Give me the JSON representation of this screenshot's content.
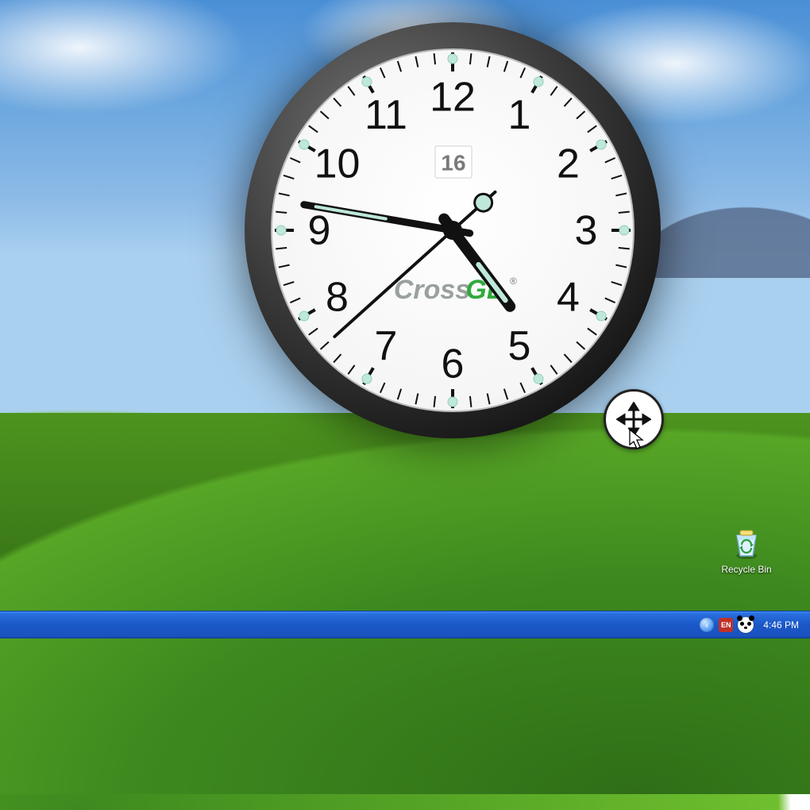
{
  "clock": {
    "numerals": [
      "12",
      "1",
      "2",
      "3",
      "4",
      "5",
      "6",
      "7",
      "8",
      "9",
      "10",
      "11"
    ],
    "date_box": "16",
    "brand_gray": "Cross",
    "brand_green": "GL",
    "brand_suffix": "®",
    "hour": 4,
    "minute": 46,
    "second": 38
  },
  "desktop": {
    "recycle_label": "Recycle Bin"
  },
  "taskbar": {
    "hide_arrow": "‹",
    "tray_app1": "EN",
    "time": "4:46 PM"
  }
}
